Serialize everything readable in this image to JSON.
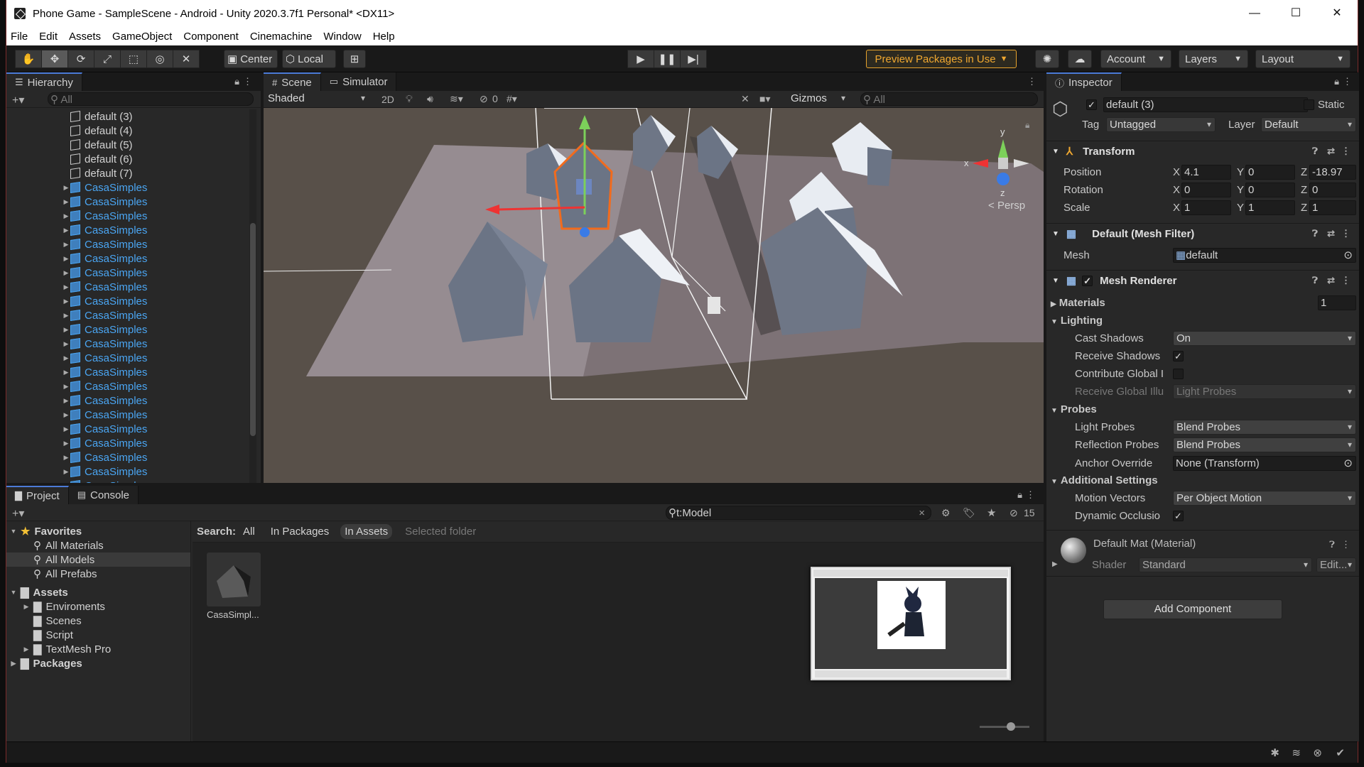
{
  "window": {
    "title": "Phone Game - SampleScene - Android - Unity 2020.3.7f1 Personal* <DX11>",
    "minimize": "—",
    "maximize": "☐",
    "close": "✕"
  },
  "menu": [
    "File",
    "Edit",
    "Assets",
    "GameObject",
    "Component",
    "Cinemachine",
    "Window",
    "Help"
  ],
  "toolbar": {
    "center": "Center",
    "local": "Local",
    "preview_packages": "Preview Packages in Use",
    "account": "Account",
    "layers": "Layers",
    "layout": "Layout"
  },
  "hierarchy": {
    "tab": "Hierarchy",
    "search_placeholder": "All",
    "items": [
      "default (3)",
      "default (4)",
      "default (5)",
      "default (6)",
      "default (7)",
      "CasaSimples",
      "CasaSimples",
      "CasaSimples",
      "CasaSimples",
      "CasaSimples",
      "CasaSimples",
      "CasaSimples",
      "CasaSimples",
      "CasaSimples",
      "CasaSimples",
      "CasaSimples",
      "CasaSimples",
      "CasaSimples",
      "CasaSimples",
      "CasaSimples",
      "CasaSimples",
      "CasaSimples",
      "CasaSimples",
      "CasaSimples",
      "CasaSimples",
      "CasaSimples",
      "CasaSimples"
    ]
  },
  "scene": {
    "tab_scene": "Scene",
    "tab_simulator": "Simulator",
    "shading": "Shaded",
    "mode_2d": "2D",
    "hidden_count": "0",
    "gizmos": "Gizmos",
    "search_placeholder": "All",
    "persp": "Persp",
    "axis_y": "y",
    "axis_x": "x",
    "axis_z": "z"
  },
  "inspector": {
    "tab": "Inspector",
    "object_name": "default (3)",
    "static": "Static",
    "tag_label": "Tag",
    "tag": "Untagged",
    "layer_label": "Layer",
    "layer": "Default",
    "transform": {
      "title": "Transform",
      "position_label": "Position",
      "position": {
        "x": "4.1",
        "y": "0",
        "z": "-18.97"
      },
      "rotation_label": "Rotation",
      "rotation": {
        "x": "0",
        "y": "0",
        "z": "0"
      },
      "scale_label": "Scale",
      "scale": {
        "x": "1",
        "y": "1",
        "z": "1"
      },
      "x": "X",
      "y": "Y",
      "z": "Z"
    },
    "mesh_filter": {
      "title": "Default (Mesh Filter)",
      "mesh_label": "Mesh",
      "mesh": "default"
    },
    "mesh_renderer": {
      "title": "Mesh Renderer",
      "materials_label": "Materials",
      "materials_count": "1",
      "lighting": "Lighting",
      "cast_shadows_label": "Cast Shadows",
      "cast_shadows": "On",
      "receive_shadows_label": "Receive Shadows",
      "contribute_gi_label": "Contribute Global I",
      "receive_gi_label": "Receive Global Illu",
      "receive_gi": "Light Probes",
      "probes": "Probes",
      "light_probes_label": "Light Probes",
      "light_probes": "Blend Probes",
      "reflection_probes_label": "Reflection Probes",
      "reflection_probes": "Blend Probes",
      "anchor_override_label": "Anchor Override",
      "anchor_override": "None (Transform)",
      "additional": "Additional Settings",
      "motion_vectors_label": "Motion Vectors",
      "motion_vectors": "Per Object Motion",
      "dynamic_occlusion_label": "Dynamic Occlusio"
    },
    "material": {
      "title": "Default Mat (Material)",
      "shader_label": "Shader",
      "shader": "Standard",
      "edit": "Edit..."
    },
    "add_component": "Add Component"
  },
  "project": {
    "tab_project": "Project",
    "tab_console": "Console",
    "search_value": "t:Model",
    "hidden_count": "15",
    "favorites": "Favorites",
    "favorite_items": [
      "All Materials",
      "All Models",
      "All Prefabs"
    ],
    "assets": "Assets",
    "asset_folders": [
      "Enviroments",
      "Scenes",
      "Script",
      "TextMesh Pro"
    ],
    "packages": "Packages",
    "search_label": "Search:",
    "search_scopes": [
      "All",
      "In Packages",
      "In Assets",
      "Selected folder"
    ],
    "asset_name": "CasaSimpl..."
  },
  "colors": {
    "accent": "#4c7bd8",
    "prefab_blue": "#4aa5f2",
    "selection_orange": "#f26b1d",
    "preview_orange": "#e7a32c"
  }
}
